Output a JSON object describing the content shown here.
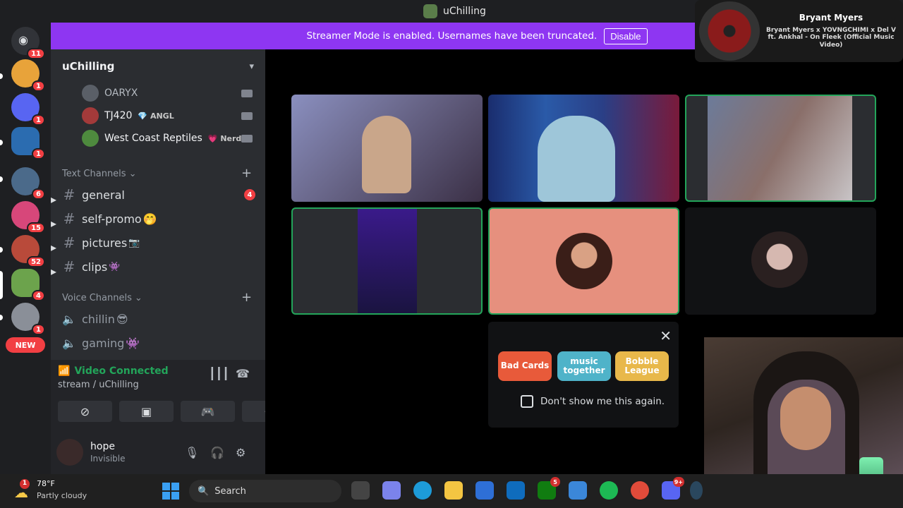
{
  "window": {
    "title": "uChilling"
  },
  "banner": {
    "message": "Streamer Mode is enabled. Usernames have been truncated.",
    "disable_label": "Disable"
  },
  "server_rail": {
    "items": [
      {
        "name": "discord-home",
        "badge": "11",
        "color": "#313338"
      },
      {
        "name": "snooze-server",
        "badge": "1",
        "color": "#e8a33a"
      },
      {
        "name": "discord-server",
        "badge": "1",
        "color": "#5865f2"
      },
      {
        "name": "blue-server",
        "badge": "1",
        "color": "#2b6cb0"
      },
      {
        "name": "avatar-server-a",
        "badge": "6",
        "color": "#4b6a8a"
      },
      {
        "name": "pink-server",
        "badge": "15",
        "color": "#d7477a"
      },
      {
        "name": "avatar-server-b",
        "badge": "52",
        "color": "#b94a3a"
      },
      {
        "name": "uchilling-server",
        "badge": "4",
        "color": "#6ca34c"
      },
      {
        "name": "house-server",
        "badge": "1",
        "color": "#8a8f98"
      }
    ],
    "new_label": "NEW"
  },
  "channels": {
    "server_name": "uChilling",
    "voice_users": [
      {
        "name": "OARYX",
        "tag": "",
        "color": "#5a5f67"
      },
      {
        "name": "TJ420",
        "tag": "ANGL",
        "tag_icon": "💎",
        "color": "#a33a3a"
      },
      {
        "name": "West Coast Reptiles",
        "tag": "Nerd",
        "tag_icon": "💗",
        "color": "#4e8a3e"
      }
    ],
    "text_category": "Text Channels",
    "text_channels": [
      {
        "name": "general",
        "emoji": "",
        "badge": "4"
      },
      {
        "name": "self-promo",
        "emoji": "🤭",
        "badge": ""
      },
      {
        "name": "pictures",
        "emoji": "📷",
        "badge": ""
      },
      {
        "name": "clips",
        "emoji": "👾",
        "badge": ""
      }
    ],
    "voice_category": "Voice Channels",
    "voice_channels": [
      {
        "name": "chillin",
        "emoji": "😎"
      },
      {
        "name": "gaming",
        "emoji": "👾"
      }
    ]
  },
  "voice_panel": {
    "status": "Video Connected",
    "location": "stream / uChilling"
  },
  "user_panel": {
    "name": "hope",
    "status": "Invisible"
  },
  "promo": {
    "activities": [
      {
        "label": "Bad Cards",
        "color": "#e85a3a"
      },
      {
        "label": "music together",
        "color": "#4fb3c9"
      },
      {
        "label": "Bobble League",
        "color": "#e8b84a"
      }
    ],
    "dont_show_label": "Don't show me this again."
  },
  "now_playing": {
    "artist": "Bryant Myers",
    "song": "Bryant Myers x YOVNGCHIMI x Del V ft. Ankhal - On Fleek (Official Music Video)"
  },
  "taskbar": {
    "temperature": "78°F",
    "condition": "Partly cloudy",
    "weather_badge": "1",
    "search_placeholder": "Search",
    "apps": [
      {
        "name": "teams-app",
        "color": "#7b83eb",
        "badge": ""
      },
      {
        "name": "edge-app",
        "color": "#1d9bd8",
        "badge": ""
      },
      {
        "name": "explorer-app",
        "color": "#f4c542",
        "badge": ""
      },
      {
        "name": "store-app",
        "color": "#2e6fd6",
        "badge": ""
      },
      {
        "name": "outlook-app",
        "color": "#0f6cbd",
        "badge": ""
      },
      {
        "name": "xbox-app",
        "color": "#107c10",
        "badge": "5"
      },
      {
        "name": "notepad-app",
        "color": "#3b87d9",
        "badge": ""
      },
      {
        "name": "spotify-app",
        "color": "#1db954",
        "badge": ""
      },
      {
        "name": "chrome-app",
        "color": "#e04b3a",
        "badge": ""
      },
      {
        "name": "discord-app",
        "color": "#5865f2",
        "badge": "9+"
      },
      {
        "name": "steam-app",
        "color": "#2a475e",
        "badge": ""
      }
    ]
  }
}
